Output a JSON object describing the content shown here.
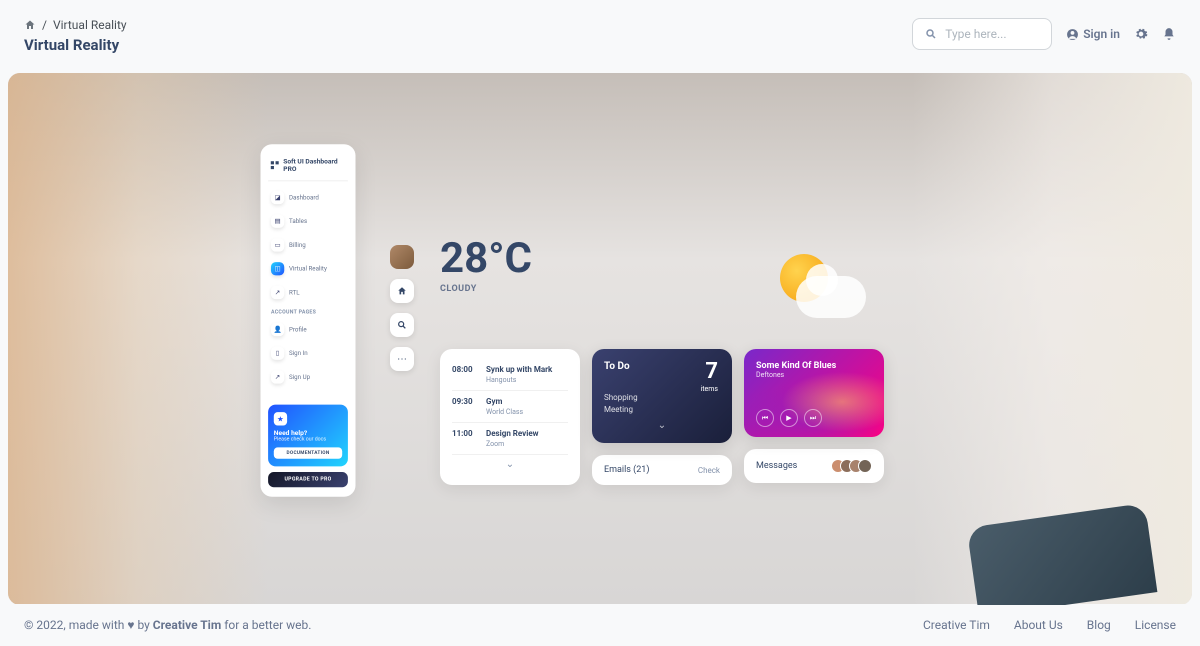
{
  "breadcrumb": {
    "current": "Virtual Reality"
  },
  "page_title": "Virtual Reality",
  "search": {
    "placeholder": "Type here..."
  },
  "signin_label": "Sign in",
  "sidebar": {
    "brand": "Soft UI Dashboard PRO",
    "items": [
      {
        "label": "Dashboard",
        "icon": "shop"
      },
      {
        "label": "Tables",
        "icon": "table"
      },
      {
        "label": "Billing",
        "icon": "credit"
      },
      {
        "label": "Virtual Reality",
        "icon": "cube",
        "active": true
      },
      {
        "label": "RTL",
        "icon": "tool"
      }
    ],
    "section_label": "ACCOUNT PAGES",
    "account_items": [
      {
        "label": "Profile",
        "icon": "user"
      },
      {
        "label": "Sign In",
        "icon": "doc"
      },
      {
        "label": "Sign Up",
        "icon": "rocket"
      }
    ],
    "help": {
      "title": "Need help?",
      "sub": "Please check our docs",
      "btn": "DOCUMENTATION"
    },
    "upgrade": "UPGRADE TO PRO"
  },
  "weather": {
    "temperature": "28°C",
    "condition": "CLOUDY"
  },
  "schedule": [
    {
      "time": "08:00",
      "title": "Synk up with Mark",
      "sub": "Hangouts"
    },
    {
      "time": "09:30",
      "title": "Gym",
      "sub": "World Class"
    },
    {
      "time": "11:00",
      "title": "Design Review",
      "sub": "Zoom"
    }
  ],
  "todo": {
    "label": "To Do",
    "count": "7",
    "items_label": "items",
    "list": [
      "Shopping",
      "Meeting"
    ]
  },
  "emails": {
    "label": "Emails (21)",
    "action": "Check"
  },
  "music": {
    "song": "Some Kind Of Blues",
    "artist": "Deftones"
  },
  "messages": {
    "label": "Messages"
  },
  "footer": {
    "copyright_prefix": "© 2022, made with",
    "by": "by",
    "author": "Creative Tim",
    "suffix": "for a better web.",
    "links": [
      "Creative Tim",
      "About Us",
      "Blog",
      "License"
    ]
  }
}
